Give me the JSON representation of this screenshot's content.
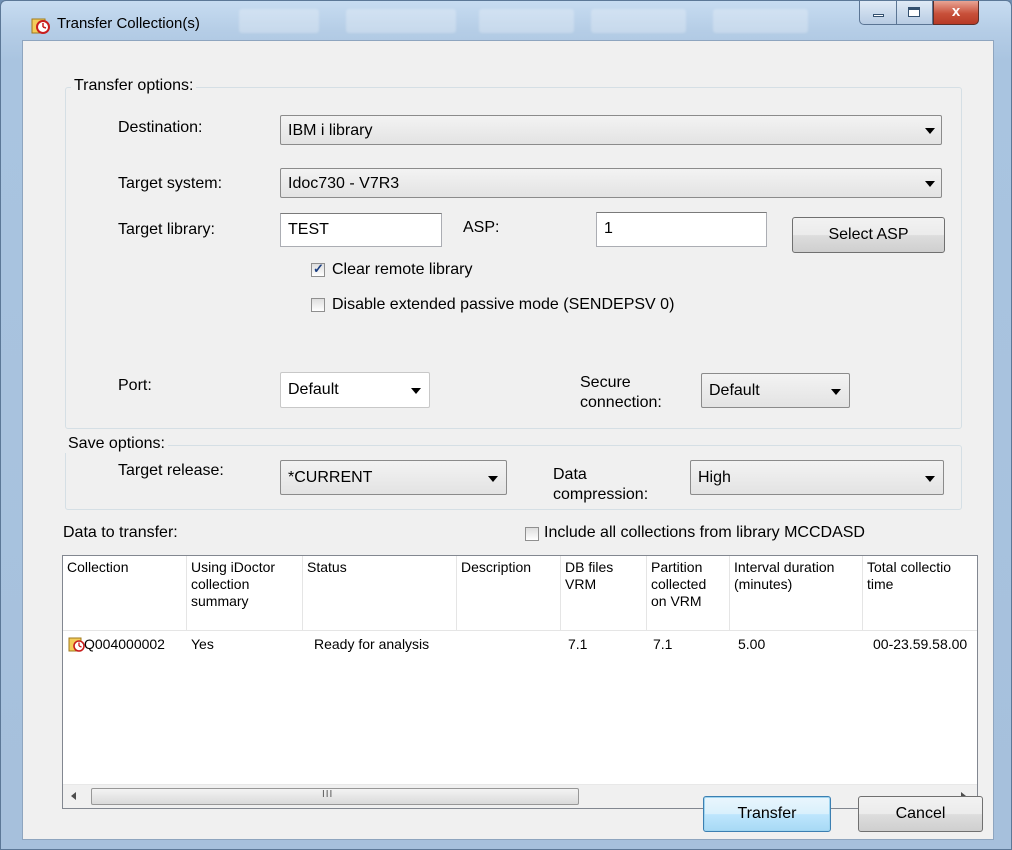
{
  "window": {
    "title": "Transfer Collection(s)",
    "close_glyph": "x"
  },
  "transfer_options": {
    "group_label": "Transfer options:",
    "destination_label": "Destination:",
    "destination_value": "IBM i library",
    "target_system_label": "Target system:",
    "target_system_value": "Idoc730 - V7R3",
    "target_library_label": "Target library:",
    "target_library_value": "TEST",
    "asp_label": "ASP:",
    "asp_value": "1",
    "select_asp_label": "Select ASP",
    "clear_remote_label": "Clear remote library",
    "clear_remote_checked": true,
    "disable_passive_label": "Disable extended passive mode (SENDEPSV 0)",
    "disable_passive_checked": false,
    "port_label": "Port:",
    "port_value": "Default",
    "secure_label_1": "Secure",
    "secure_label_2": "connection:",
    "secure_value": "Default"
  },
  "save_options": {
    "group_label": "Save options:",
    "target_release_label": "Target release:",
    "target_release_value": "*CURRENT",
    "compression_label_1": "Data",
    "compression_label_2": "compression:",
    "compression_value": "High"
  },
  "data_to_transfer": {
    "label": "Data to transfer:",
    "include_all_label": "Include all collections from library MCCDASD",
    "include_all_checked": false,
    "columns": [
      {
        "l1": "Collection",
        "l2": "",
        "l3": ""
      },
      {
        "l1": "Using iDoctor",
        "l2": "collection",
        "l3": "summary"
      },
      {
        "l1": "Status",
        "l2": "",
        "l3": ""
      },
      {
        "l1": "Description",
        "l2": "",
        "l3": ""
      },
      {
        "l1": "DB files",
        "l2": "VRM",
        "l3": ""
      },
      {
        "l1": "Partition",
        "l2": "collected",
        "l3": "on VRM"
      },
      {
        "l1": "Interval duration",
        "l2": "(minutes)",
        "l3": ""
      },
      {
        "l1": "Total collectio",
        "l2": "time",
        "l3": ""
      }
    ],
    "rows": [
      {
        "collection": "Q004000002",
        "using_idoctor": "Yes",
        "status": "Ready for analysis",
        "description": "",
        "db_files_vrm": "7.1",
        "partition_vrm": "7.1",
        "interval": "5.00",
        "total_time": "00-23.59.58.00"
      }
    ],
    "scroll_grip": "III"
  },
  "buttons": {
    "transfer": "Transfer",
    "cancel": "Cancel"
  },
  "colors": {
    "accent": "#3c7fb1",
    "client_bg": "#f0f0f0"
  }
}
